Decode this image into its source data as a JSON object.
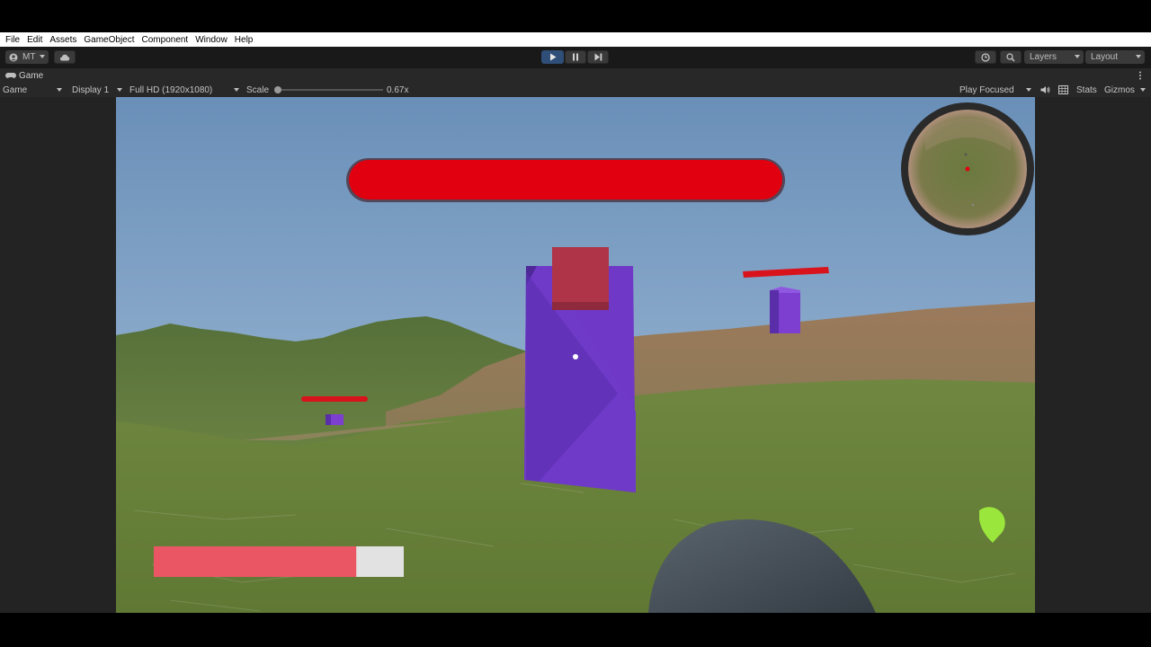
{
  "menu": [
    "File",
    "Edit",
    "Assets",
    "GameObject",
    "Component",
    "Window",
    "Help"
  ],
  "toolbar": {
    "account_label": "MT",
    "layers_label": "Layers",
    "layout_label": "Layout"
  },
  "game_tab": {
    "label": "Game"
  },
  "game_bar": {
    "view_mode": "Game",
    "display": "Display 1",
    "resolution": "Full HD (1920x1080)",
    "scale_label": "Scale",
    "scale_value": "0.67x",
    "play_mode": "Play Focused",
    "stats_label": "Stats",
    "gizmos_label": "Gizmos"
  },
  "hud": {
    "enemy_health_fraction": 1.0,
    "player_health_fraction": 0.81,
    "colors": {
      "enemy_health": "#e0000f",
      "player_health": "#eb5665",
      "player_health_bg": "#e2e2e2",
      "reload_indicator": "#9be63c",
      "minimap_ring": "#2a2a2a"
    }
  },
  "icons": [
    "account-icon",
    "cloud-icon",
    "play-icon",
    "pause-icon",
    "step-icon",
    "history-icon",
    "search-icon",
    "audio-icon",
    "stats-grid-icon",
    "game-controller-icon",
    "kebab-menu-icon"
  ]
}
